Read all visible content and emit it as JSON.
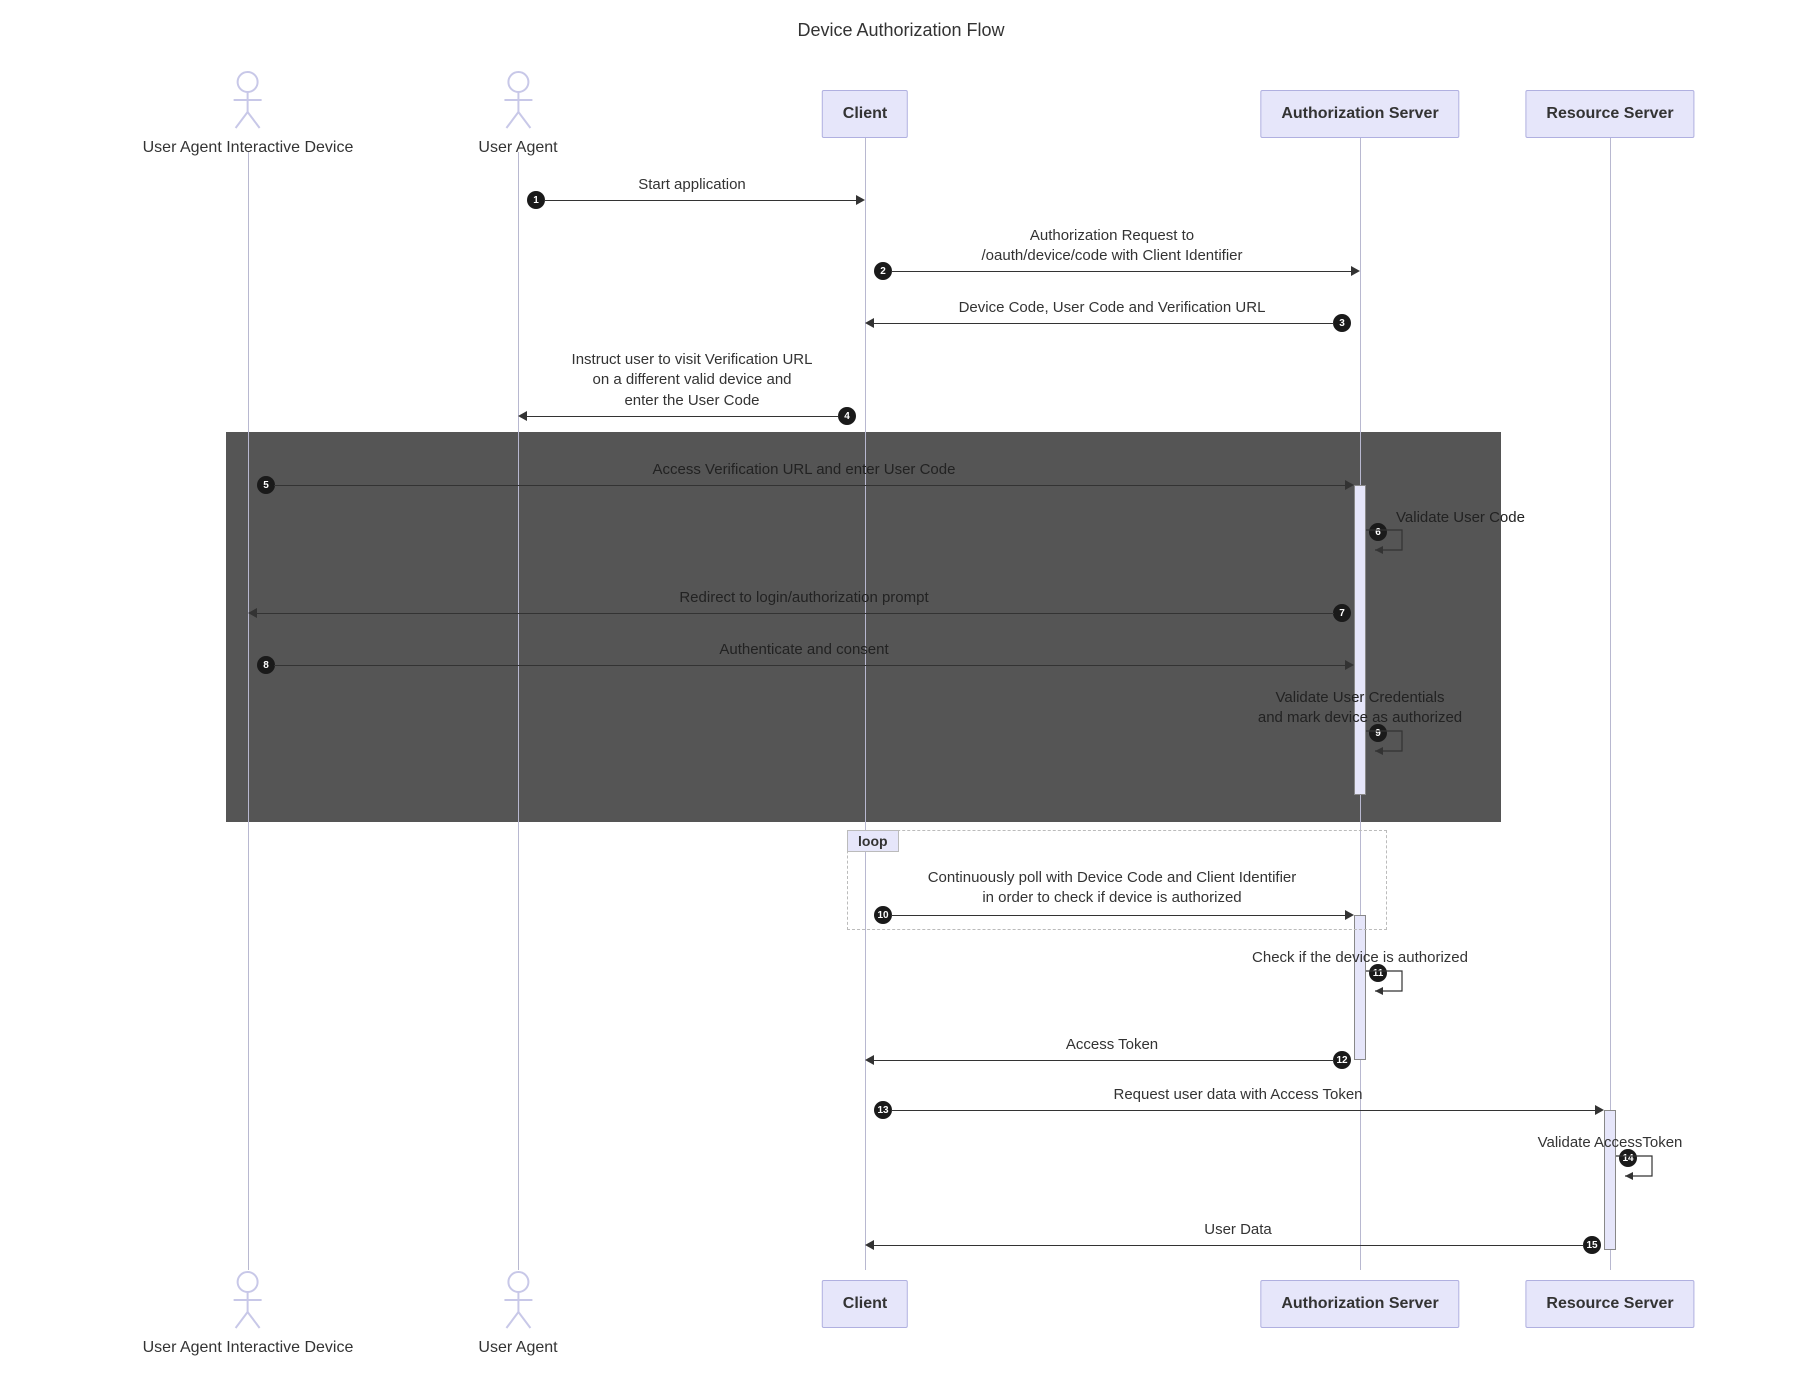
{
  "title": "Device Authorization Flow",
  "participants": {
    "uaid": "User Agent Interactive Device",
    "ua": "User Agent",
    "client": "Client",
    "auth": "Authorization Server",
    "resource": "Resource Server"
  },
  "loop_label": "loop",
  "messages": {
    "m1": "Start application",
    "m2": "Authorization Request to\n/oauth/device/code with Client Identifier",
    "m3": "Device Code, User Code and Verification URL",
    "m4": "Instruct user to visit Verification URL\non a different valid device and\nenter the User Code",
    "m5": "Access Verification URL and enter User Code",
    "m6": "Validate User Code",
    "m7": "Redirect to login/authorization prompt",
    "m8": "Authenticate and consent",
    "m9": "Validate User Credentials\nand mark device as authorized",
    "m10": "Continuously poll with Device Code and Client Identifier\nin order to check if device is authorized",
    "m11": "Check if the device is authorized",
    "m12": "Access Token",
    "m13": "Request user data with Access Token",
    "m14": "Validate AccessToken",
    "m15": "User Data"
  },
  "seq": {
    "n1": "1",
    "n2": "2",
    "n3": "3",
    "n4": "4",
    "n5": "5",
    "n6": "6",
    "n7": "7",
    "n8": "8",
    "n9": "9",
    "n10": "10",
    "n11": "11",
    "n12": "12",
    "n13": "13",
    "n14": "14",
    "n15": "15"
  }
}
